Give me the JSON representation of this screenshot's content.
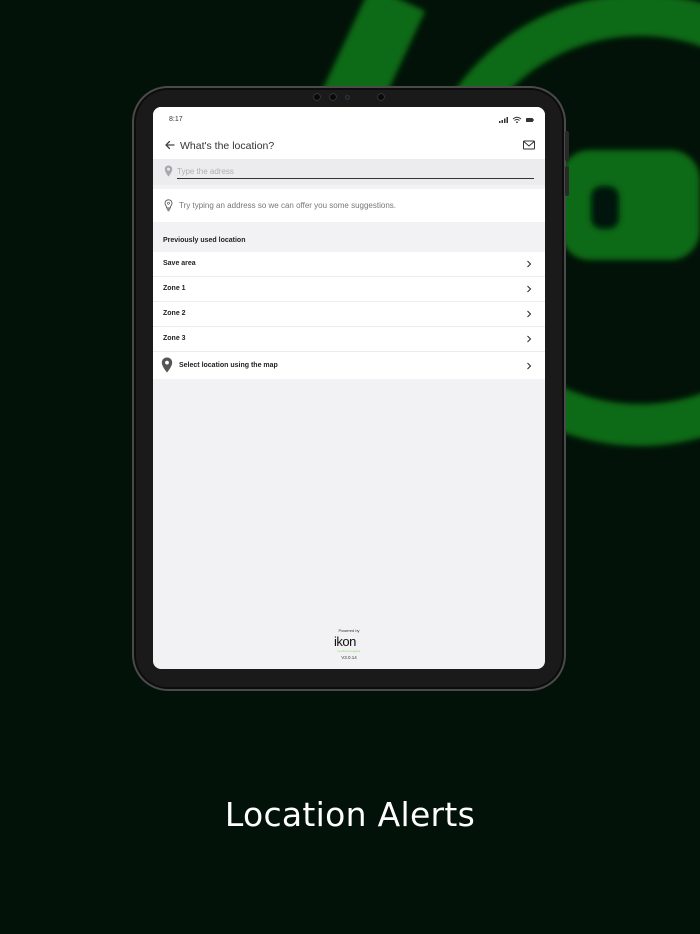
{
  "colors": {
    "background": "#021208",
    "accent_green": "#1faa22",
    "logo_green": "#7ac943"
  },
  "status_bar": {
    "time": "8:17",
    "icons": [
      "signal-icon",
      "wifi-icon",
      "battery-icon"
    ]
  },
  "header": {
    "back_icon": "arrow-left-icon",
    "title": "What's the location?",
    "mail_icon": "mail-icon"
  },
  "search": {
    "placeholder": "Type the adress",
    "value": "",
    "icon": "location-pin-icon"
  },
  "suggestion": {
    "icon": "lightbulb-icon",
    "text": "Try typing an address so we can  offer you some suggestions."
  },
  "previous_locations": {
    "title": "Previously used location",
    "items": [
      {
        "label": "Save area"
      },
      {
        "label": "Zone 1"
      },
      {
        "label": "Zone 2"
      },
      {
        "label": "Zone 3"
      }
    ]
  },
  "map_option": {
    "label": "Select location using the map",
    "icon": "map-pin-icon"
  },
  "footer": {
    "powered_by": "Powered by",
    "brand": "ikon",
    "brand_sub": "technologies",
    "version": "V3.0.14"
  },
  "caption": "Location Alerts"
}
